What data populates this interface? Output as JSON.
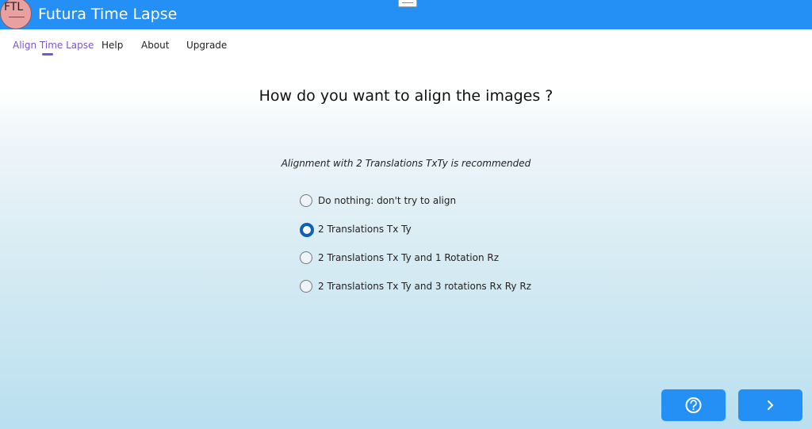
{
  "app": {
    "title": "Futura Time Lapse",
    "logo_text": "FTL"
  },
  "menu": {
    "items": [
      {
        "label": "Align Time Lapse",
        "active": true
      },
      {
        "label": "Help",
        "active": false
      },
      {
        "label": "About",
        "active": false
      },
      {
        "label": "Upgrade",
        "active": false
      }
    ]
  },
  "main": {
    "question": "How do you want to align the images ?",
    "hint": "Alignment with 2 Translations TxTy is recommended",
    "options": [
      {
        "label": "Do nothing: don't try to align",
        "checked": false
      },
      {
        "label": "2 Translations Tx Ty",
        "checked": true
      },
      {
        "label": "2 Translations Tx Ty and 1 Rotation Rz",
        "checked": false
      },
      {
        "label": "2 Translations Tx Ty and 3 rotations Rx Ry Rz",
        "checked": false
      }
    ]
  },
  "buttons": {
    "help_icon": "help-circle-icon",
    "next_icon": "chevron-right-icon"
  },
  "colors": {
    "accent": "#2490f6",
    "active_menu": "#7a55c9",
    "radio_selected": "#0f5fb4"
  }
}
